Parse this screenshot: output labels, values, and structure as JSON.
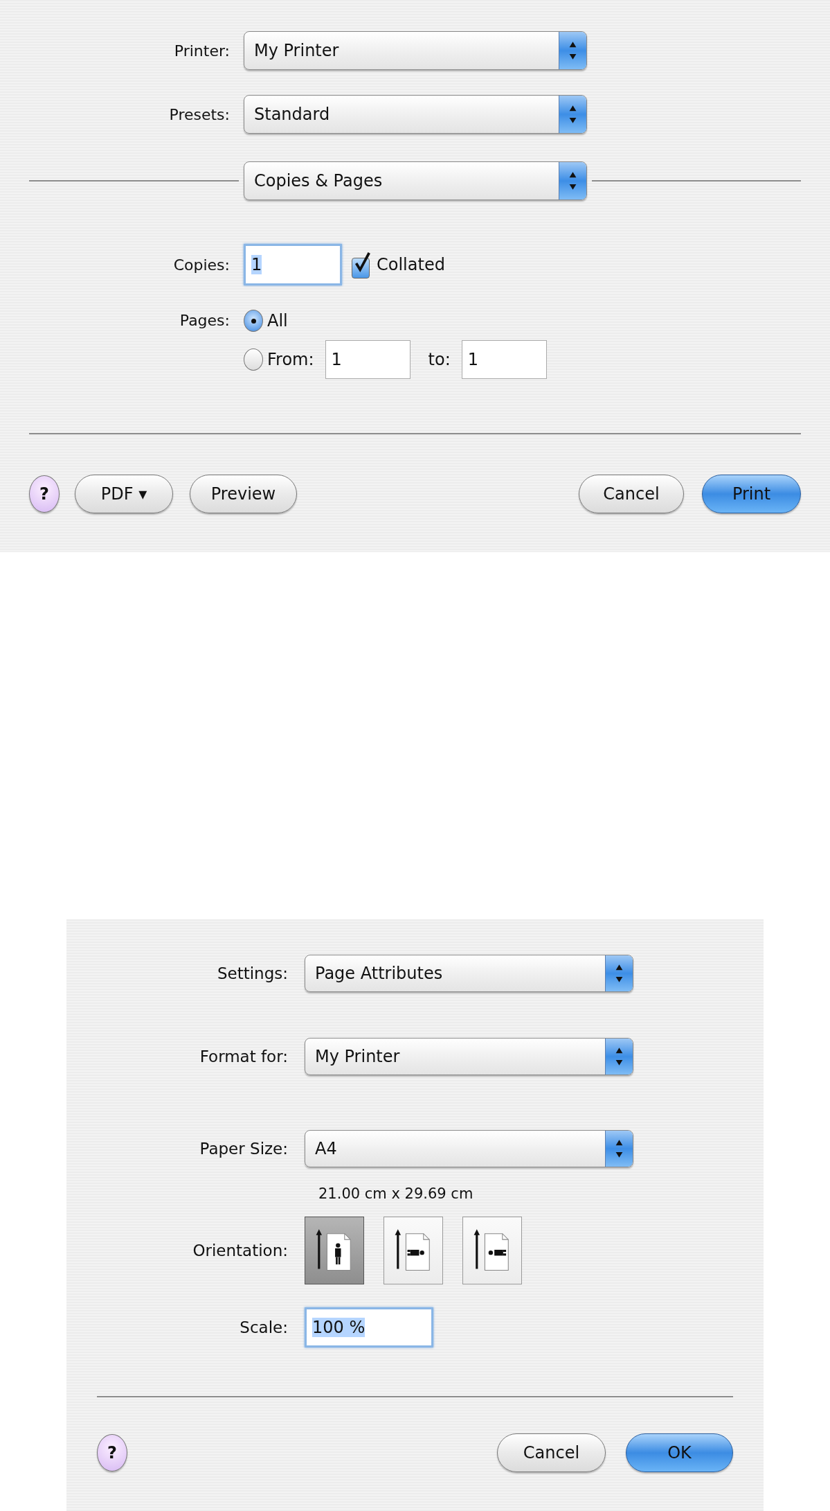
{
  "print_dialog": {
    "popups": [
      {
        "label": "Printer:",
        "value": "My Printer"
      },
      {
        "label": "Presets:",
        "value": "Standard"
      }
    ],
    "pane_menu": {
      "value": "Copies & Pages"
    },
    "copies": {
      "label": "Copies:",
      "value": "1",
      "focused": true,
      "collated": {
        "label": "Collated",
        "checked": true
      }
    },
    "pages": {
      "label": "Pages:",
      "options": [
        {
          "kind": "all",
          "label": "All",
          "selected": true
        },
        {
          "kind": "range",
          "label": "From:",
          "selected": false,
          "from": "1",
          "to_label": "to:",
          "to": "1"
        }
      ]
    },
    "buttons": [
      {
        "kind": "help",
        "label": "?"
      },
      {
        "kind": "push",
        "label": "PDF ▾"
      },
      {
        "kind": "push",
        "label": "Preview"
      },
      {
        "kind": "push",
        "label": "Cancel"
      },
      {
        "kind": "default",
        "label": "Print"
      }
    ]
  },
  "page_setup_dialog": {
    "popups": [
      {
        "label": "Settings:",
        "value": "Page Attributes"
      },
      {
        "label": "Format for:",
        "value": "My Printer"
      },
      {
        "label": "Paper Size:",
        "value": "A4"
      }
    ],
    "paper_dimensions": "21.00 cm x 29.69 cm",
    "orientation": {
      "label": "Orientation:",
      "options": [
        {
          "kind": "portrait",
          "selected": true
        },
        {
          "kind": "landscape-left",
          "selected": false
        },
        {
          "kind": "landscape-right",
          "selected": false
        }
      ]
    },
    "scale": {
      "label": "Scale:",
      "value": "100 %",
      "focused": true
    },
    "buttons": [
      {
        "kind": "help",
        "label": "?"
      },
      {
        "kind": "push",
        "label": "Cancel"
      },
      {
        "kind": "default",
        "label": "OK"
      }
    ]
  }
}
